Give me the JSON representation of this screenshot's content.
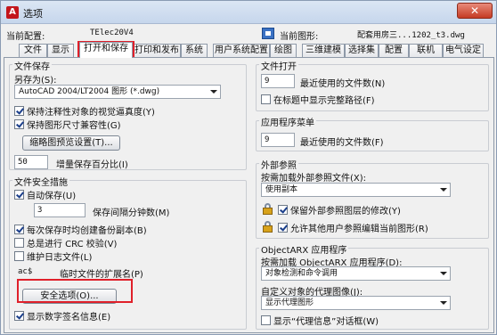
{
  "window": {
    "title": "选项",
    "close_glyph": "✕",
    "app_icon_glyph": "A"
  },
  "info": {
    "profile_label": "当前配置:",
    "profile_value": "TElec20V4",
    "drawing_label": "当前图形:",
    "drawing_value": "配套用房三...1202_t3.dwg"
  },
  "tabs": [
    "文件",
    "显示",
    "打开和保存",
    "打印和发布",
    "系统",
    "用户系统配置",
    "绘图",
    "三维建模",
    "选择集",
    "配置",
    "联机",
    "电气设定"
  ],
  "file_save": {
    "title": "文件保存",
    "save_as_label": "另存为(S):",
    "save_as_value": "AutoCAD 2004/LT2004 图形 (*.dwg)",
    "keep_annotative": "保持注释性对象的视觉逼真度(Y)",
    "keep_drawing_size": "保持图形尺寸兼容性(G)",
    "thumbnail_button": "缩略图预览设置(T)...",
    "incremental_value": "50",
    "incremental_label": "增量保存百分比(I)"
  },
  "file_safety": {
    "title": "文件安全措施",
    "autosave": "自动保存(U)",
    "autosave_minutes": "3",
    "autosave_minutes_label": "保存间隔分钟数(M)",
    "backup_copy": "每次保存时均创建备份副本(B)",
    "crc_check": "总是进行 CRC 校验(V)",
    "log_file": "维护日志文件(L)",
    "temp_ext_value": "ac$",
    "temp_ext_label": "临时文件的扩展名(P)",
    "security_button": "安全选项(O)...",
    "digital_signature": "显示数字签名信息(E)"
  },
  "file_open": {
    "title": "文件打开",
    "recent_count": "9",
    "recent_label": "最近使用的文件数(N)",
    "full_path": "在标题中显示完整路径(F)"
  },
  "app_menu": {
    "title": "应用程序菜单",
    "recent_count": "9",
    "recent_label": "最近使用的文件数(F)"
  },
  "xref": {
    "title": "外部参照",
    "demand_load_label": "按需加载外部参照文件(X):",
    "demand_load_value": "使用副本",
    "retain_changes": "保留外部参照图层的修改(Y)",
    "allow_edit": "允许其他用户参照编辑当前图形(R)"
  },
  "objectarx": {
    "title": "ObjectARX 应用程序",
    "demand_load_label": "按需加载 ObjectARX 应用程序(D):",
    "demand_load_value": "对象检测和命令调用",
    "proxy_label": "自定义对象的代理图像(J):",
    "proxy_value": "显示代理图形",
    "proxy_info": "显示“代理信息”对话框(W)"
  },
  "colors": {
    "highlight": "#e0202a",
    "title_gradient": "#c6d6ec"
  }
}
